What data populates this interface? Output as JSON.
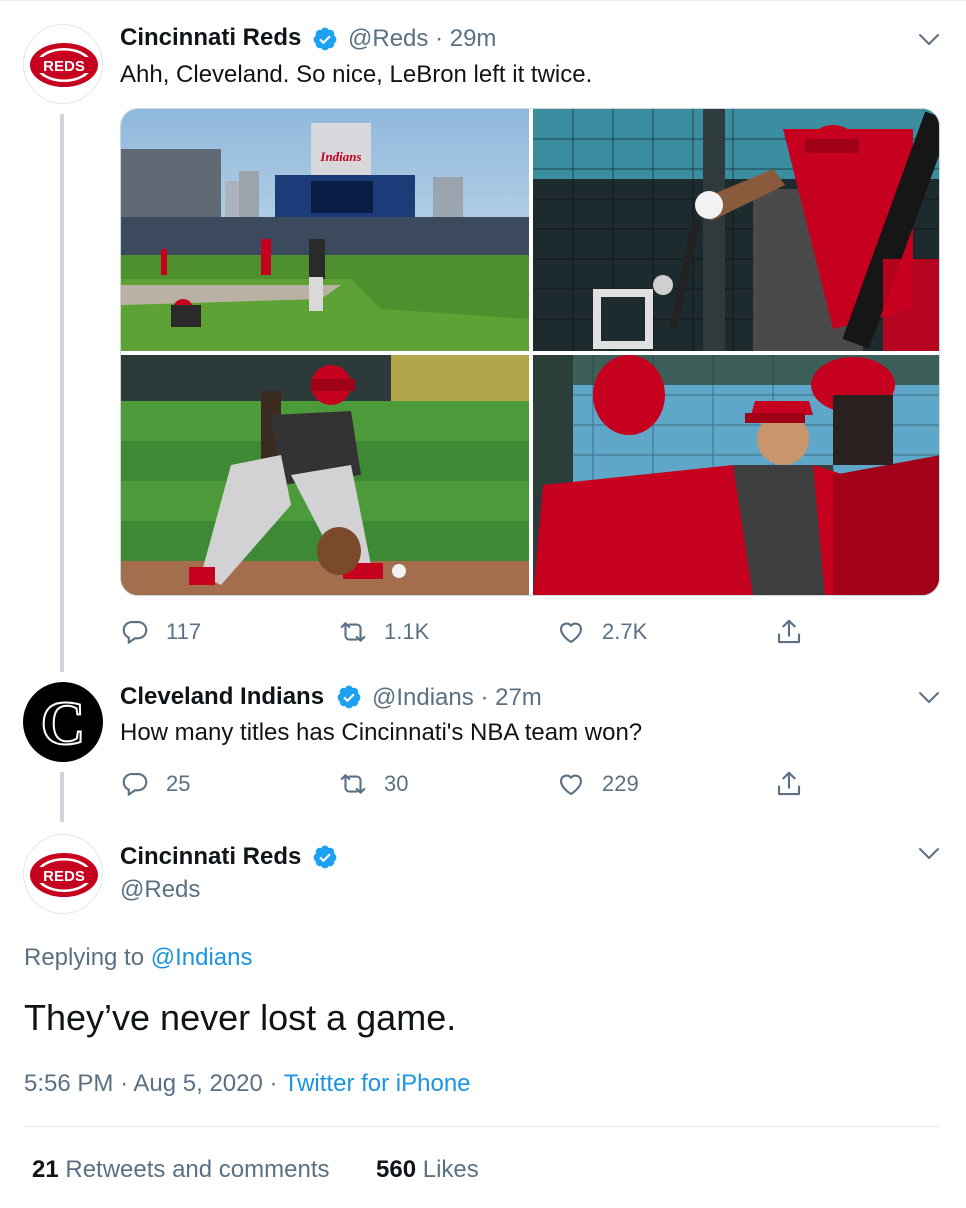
{
  "tweet1": {
    "author_name": "Cincinnati Reds",
    "handle": "@Reds",
    "separator": "·",
    "time": "29m",
    "text": "Ahh, Cleveland. So nice, LeBron left it twice.",
    "avatar_text": "REDS",
    "photos": [
      {
        "name": "ballpark-field-photo",
        "scoreboard_text": "Indians"
      },
      {
        "name": "batting-cage-photo"
      },
      {
        "name": "infielder-fielding-photo"
      },
      {
        "name": "players-talking-photo"
      }
    ],
    "replies": "117",
    "retweets": "1.1K",
    "likes": "2.7K"
  },
  "tweet2": {
    "author_name": "Cleveland Indians",
    "handle": "@Indians",
    "separator": "·",
    "time": "27m",
    "text": "How many titles has Cincinnati's NBA team won?",
    "avatar_text": "C",
    "replies": "25",
    "retweets": "30",
    "likes": "229"
  },
  "tweet3": {
    "author_name": "Cincinnati Reds",
    "handle": "@Reds",
    "avatar_text": "REDS",
    "replying_prefix": "Replying to",
    "replying_handle": "@Indians",
    "text": "They’ve never lost a game.",
    "time": "5:56 PM",
    "date": "Aug 5, 2020",
    "separator": "·",
    "source": "Twitter for iPhone",
    "retweets_count": "21",
    "retweets_label": "Retweets and comments",
    "likes_count": "560",
    "likes_label": "Likes"
  },
  "colors": {
    "verified_blue": "#1da1f2",
    "link_blue": "#1b95e0",
    "reds_red": "#c6011f",
    "secondary_text": "#5b7083"
  }
}
